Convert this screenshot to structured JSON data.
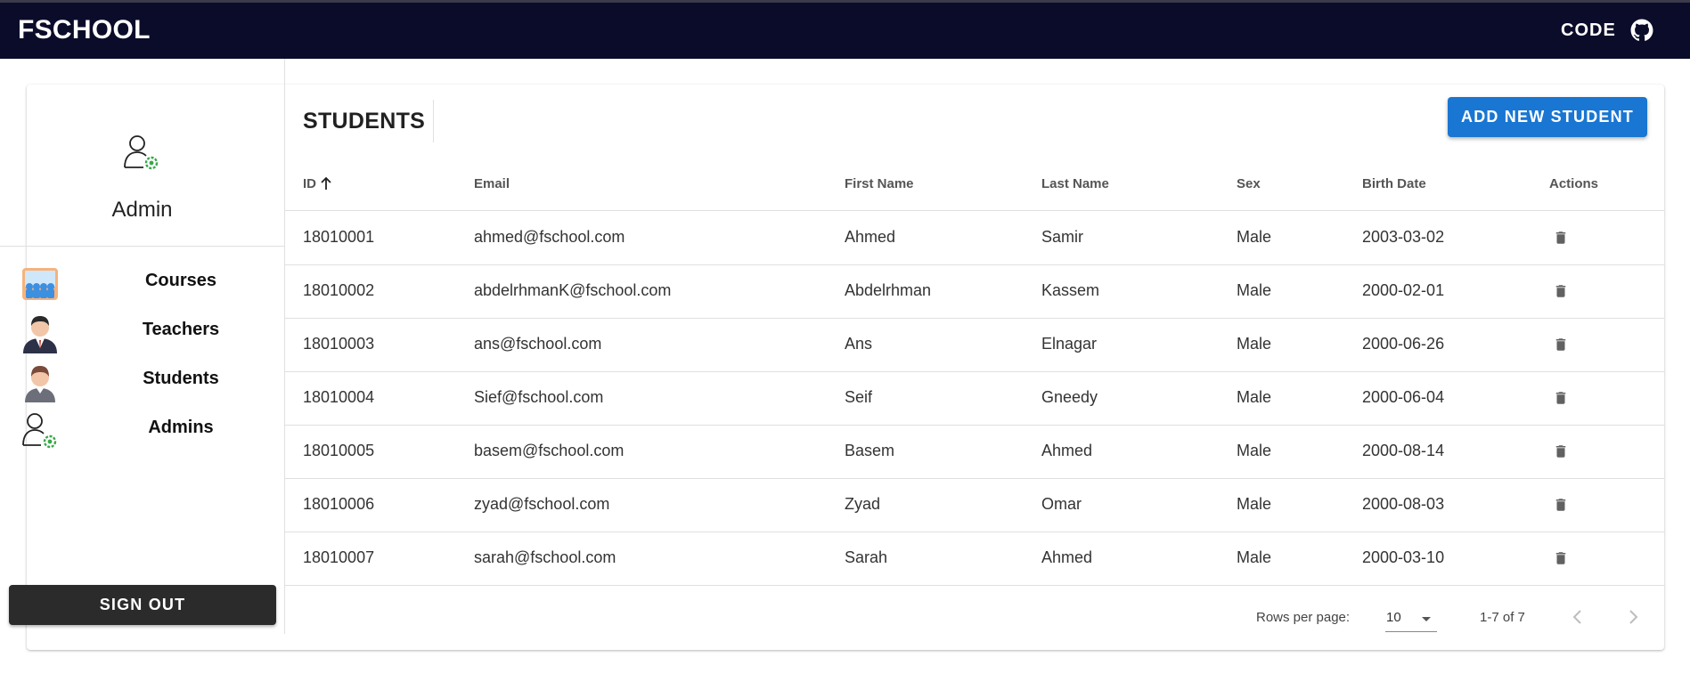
{
  "appbar": {
    "brand": "FSCHOOL",
    "code_label": "CODE",
    "icon": "github-icon"
  },
  "sidebar": {
    "user_name": "Admin",
    "user_icon": "admin-user-icon",
    "items": [
      {
        "label": "Courses",
        "icon": "courses-icon"
      },
      {
        "label": "Teachers",
        "icon": "teacher-icon"
      },
      {
        "label": "Students",
        "icon": "student-icon"
      },
      {
        "label": "Admins",
        "icon": "admin-icon"
      }
    ],
    "signout_label": "SIGN OUT"
  },
  "main": {
    "title": "STUDENTS",
    "add_button": "ADD NEW STUDENT",
    "columns": [
      "ID",
      "Email",
      "First Name",
      "Last Name",
      "Sex",
      "Birth Date",
      "Actions"
    ],
    "sorted_column": "ID",
    "sort_direction": "ascending",
    "rows": [
      {
        "id": "18010001",
        "email": "ahmed@fschool.com",
        "first": "Ahmed",
        "last": "Samir",
        "sex": "Male",
        "birth": "2003-03-02"
      },
      {
        "id": "18010002",
        "email": "abdelrhmanK@fschool.com",
        "first": "Abdelrhman",
        "last": "Kassem",
        "sex": "Male",
        "birth": "2000-02-01"
      },
      {
        "id": "18010003",
        "email": "ans@fschool.com",
        "first": "Ans",
        "last": "Elnagar",
        "sex": "Male",
        "birth": "2000-06-26"
      },
      {
        "id": "18010004",
        "email": "Sief@fschool.com",
        "first": "Seif",
        "last": "Gneedy",
        "sex": "Male",
        "birth": "2000-06-04"
      },
      {
        "id": "18010005",
        "email": "basem@fschool.com",
        "first": "Basem",
        "last": "Ahmed",
        "sex": "Male",
        "birth": "2000-08-14"
      },
      {
        "id": "18010006",
        "email": "zyad@fschool.com",
        "first": "Zyad",
        "last": "Omar",
        "sex": "Male",
        "birth": "2000-08-03"
      },
      {
        "id": "18010007",
        "email": "sarah@fschool.com",
        "first": "Sarah",
        "last": "Ahmed",
        "sex": "Male",
        "birth": "2000-03-10"
      }
    ],
    "pagination": {
      "rows_per_page_label": "Rows per page:",
      "rows_per_page": "10",
      "range": "1-7 of 7"
    }
  },
  "colors": {
    "appbar": "#0b0c2a",
    "primary": "#1976d2",
    "signout": "#2b2b2b"
  }
}
